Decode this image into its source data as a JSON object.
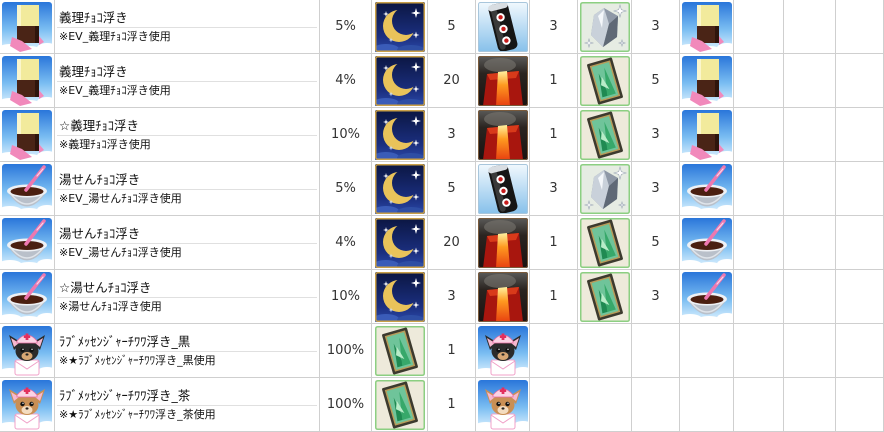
{
  "table": {
    "rows": [
      {
        "item_icon": "giri-choco-float-icon",
        "name": "義理ﾁｮｺ浮き",
        "note": "※EV_義理ﾁｮｺ浮き使用",
        "rate": "5%",
        "materials": [
          {
            "icon": "moon-icon",
            "qty": "5"
          },
          {
            "icon": "black-roll-icon",
            "qty": "3"
          },
          {
            "icon": "crystal-icon",
            "qty": "3"
          }
        ],
        "base_icon": "giri-choco-float-icon"
      },
      {
        "item_icon": "giri-choco-float-icon",
        "name": "義理ﾁｮｺ浮き",
        "note": "※EV_義理ﾁｮｺ浮き使用",
        "rate": "4%",
        "materials": [
          {
            "icon": "moon-icon",
            "qty": "20"
          },
          {
            "icon": "fire-ore-icon",
            "qty": "1"
          },
          {
            "icon": "green-card-icon",
            "qty": "5"
          }
        ],
        "base_icon": "giri-choco-float-icon"
      },
      {
        "item_icon": "giri-choco-float-icon",
        "name": "☆義理ﾁｮｺ浮き",
        "note": "※義理ﾁｮｺ浮き使用",
        "rate": "10%",
        "materials": [
          {
            "icon": "moon-icon",
            "qty": "3"
          },
          {
            "icon": "fire-ore-icon",
            "qty": "1"
          },
          {
            "icon": "green-card-icon",
            "qty": "3"
          }
        ],
        "base_icon": "giri-choco-float-icon"
      },
      {
        "item_icon": "yusen-choco-float-icon",
        "name": "湯せんﾁｮｺ浮き",
        "note": "※EV_湯せんﾁｮｺ浮き使用",
        "rate": "5%",
        "materials": [
          {
            "icon": "moon-icon",
            "qty": "5"
          },
          {
            "icon": "black-roll-icon",
            "qty": "3"
          },
          {
            "icon": "crystal-icon",
            "qty": "3"
          }
        ],
        "base_icon": "yusen-choco-float-icon"
      },
      {
        "item_icon": "yusen-choco-float-icon",
        "name": "湯せんﾁｮｺ浮き",
        "note": "※EV_湯せんﾁｮｺ浮き使用",
        "rate": "4%",
        "materials": [
          {
            "icon": "moon-icon",
            "qty": "20"
          },
          {
            "icon": "fire-ore-icon",
            "qty": "1"
          },
          {
            "icon": "green-card-icon",
            "qty": "5"
          }
        ],
        "base_icon": "yusen-choco-float-icon"
      },
      {
        "item_icon": "yusen-choco-float-icon",
        "name": "☆湯せんﾁｮｺ浮き",
        "note": "※湯せんﾁｮｺ浮き使用",
        "rate": "10%",
        "materials": [
          {
            "icon": "moon-icon",
            "qty": "3"
          },
          {
            "icon": "fire-ore-icon",
            "qty": "1"
          },
          {
            "icon": "green-card-icon",
            "qty": "3"
          }
        ],
        "base_icon": "yusen-choco-float-icon"
      },
      {
        "item_icon": "chihuahua-black-float-icon",
        "name": "ﾗﾌﾞﾒｯｾﾝｼﾞｬｰﾁﾜﾜ浮き_黒",
        "note": "※★ﾗﾌﾞﾒｯｾﾝｼﾞｬｰﾁﾜﾜ浮き_黒使用",
        "rate": "100%",
        "materials": [
          {
            "icon": "green-card-icon",
            "qty": "1"
          }
        ],
        "base_icon": "chihuahua-black-float-icon"
      },
      {
        "item_icon": "chihuahua-brown-float-icon",
        "name": "ﾗﾌﾞﾒｯｾﾝｼﾞｬｰﾁﾜﾜ浮き_茶",
        "note": "※★ﾗﾌﾞﾒｯｾﾝｼﾞｬｰﾁﾜﾜ浮き_茶使用",
        "rate": "100%",
        "materials": [
          {
            "icon": "green-card-icon",
            "qty": "1"
          }
        ],
        "base_icon": "chihuahua-brown-float-icon"
      }
    ]
  }
}
